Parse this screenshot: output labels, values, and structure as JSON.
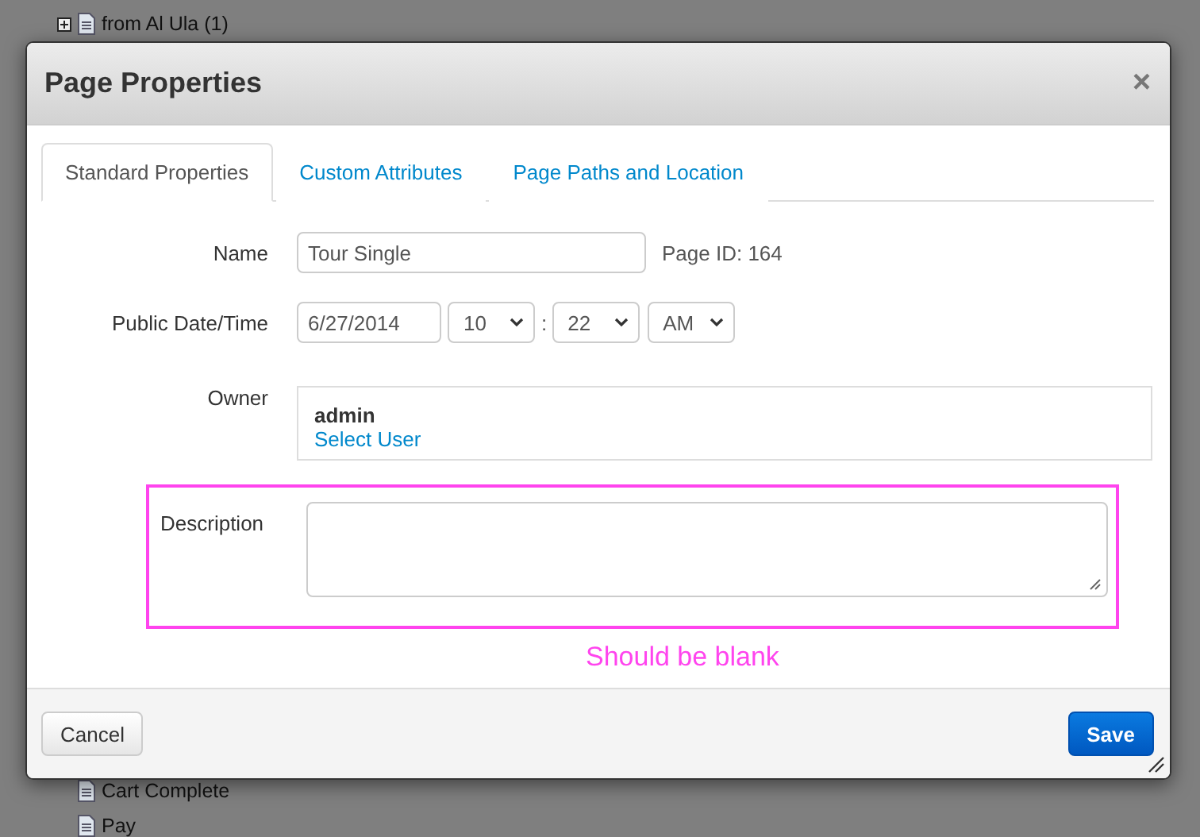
{
  "background_tree": {
    "top_items": [
      {
        "label": "from Al Ula (1)",
        "expandable": true
      }
    ],
    "bottom_items": [
      {
        "label": "Cart Complete",
        "expandable": false
      },
      {
        "label": "Pay",
        "expandable": false
      }
    ]
  },
  "dialog": {
    "title": "Page Properties",
    "close": "×",
    "tabs": [
      {
        "label": "Standard Properties",
        "selected": true
      },
      {
        "label": "Custom Attributes",
        "selected": false
      },
      {
        "label": "Page Paths and Location",
        "selected": false
      }
    ],
    "name": {
      "label": "Name",
      "value": "Tour Single",
      "page_id": "Page ID: 164"
    },
    "public_date": {
      "label": "Public Date/Time",
      "date": "6/27/2014",
      "hour": "10",
      "separator": ":",
      "minute": "22",
      "ampm": "AM"
    },
    "owner": {
      "label": "Owner",
      "user": "admin",
      "link": "Select User"
    },
    "description": {
      "label": "Description",
      "highlighted": true
    },
    "annotation": "Should be blank",
    "buttons": [
      {
        "label": "Cancel",
        "kind": "default"
      },
      {
        "label": "Save",
        "kind": "primary"
      }
    ]
  }
}
